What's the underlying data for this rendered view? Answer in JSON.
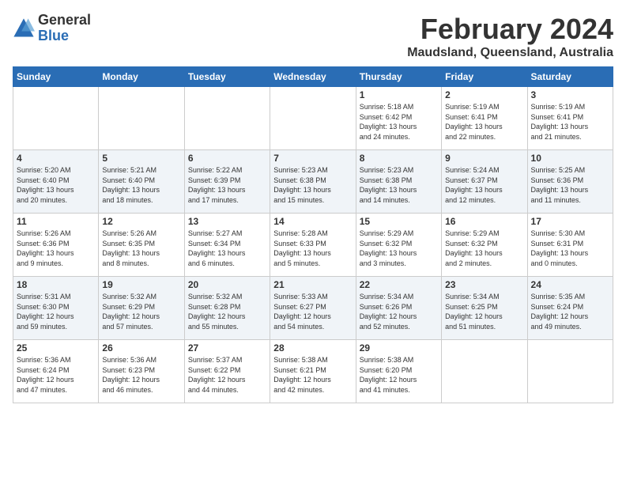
{
  "header": {
    "logo_line1": "General",
    "logo_line2": "Blue",
    "title": "February 2024",
    "subtitle": "Maudsland, Queensland, Australia"
  },
  "calendar": {
    "days_of_week": [
      "Sunday",
      "Monday",
      "Tuesday",
      "Wednesday",
      "Thursday",
      "Friday",
      "Saturday"
    ],
    "weeks": [
      [
        {
          "day": "",
          "info": ""
        },
        {
          "day": "",
          "info": ""
        },
        {
          "day": "",
          "info": ""
        },
        {
          "day": "",
          "info": ""
        },
        {
          "day": "1",
          "info": "Sunrise: 5:18 AM\nSunset: 6:42 PM\nDaylight: 13 hours\nand 24 minutes."
        },
        {
          "day": "2",
          "info": "Sunrise: 5:19 AM\nSunset: 6:41 PM\nDaylight: 13 hours\nand 22 minutes."
        },
        {
          "day": "3",
          "info": "Sunrise: 5:19 AM\nSunset: 6:41 PM\nDaylight: 13 hours\nand 21 minutes."
        }
      ],
      [
        {
          "day": "4",
          "info": "Sunrise: 5:20 AM\nSunset: 6:40 PM\nDaylight: 13 hours\nand 20 minutes."
        },
        {
          "day": "5",
          "info": "Sunrise: 5:21 AM\nSunset: 6:40 PM\nDaylight: 13 hours\nand 18 minutes."
        },
        {
          "day": "6",
          "info": "Sunrise: 5:22 AM\nSunset: 6:39 PM\nDaylight: 13 hours\nand 17 minutes."
        },
        {
          "day": "7",
          "info": "Sunrise: 5:23 AM\nSunset: 6:38 PM\nDaylight: 13 hours\nand 15 minutes."
        },
        {
          "day": "8",
          "info": "Sunrise: 5:23 AM\nSunset: 6:38 PM\nDaylight: 13 hours\nand 14 minutes."
        },
        {
          "day": "9",
          "info": "Sunrise: 5:24 AM\nSunset: 6:37 PM\nDaylight: 13 hours\nand 12 minutes."
        },
        {
          "day": "10",
          "info": "Sunrise: 5:25 AM\nSunset: 6:36 PM\nDaylight: 13 hours\nand 11 minutes."
        }
      ],
      [
        {
          "day": "11",
          "info": "Sunrise: 5:26 AM\nSunset: 6:36 PM\nDaylight: 13 hours\nand 9 minutes."
        },
        {
          "day": "12",
          "info": "Sunrise: 5:26 AM\nSunset: 6:35 PM\nDaylight: 13 hours\nand 8 minutes."
        },
        {
          "day": "13",
          "info": "Sunrise: 5:27 AM\nSunset: 6:34 PM\nDaylight: 13 hours\nand 6 minutes."
        },
        {
          "day": "14",
          "info": "Sunrise: 5:28 AM\nSunset: 6:33 PM\nDaylight: 13 hours\nand 5 minutes."
        },
        {
          "day": "15",
          "info": "Sunrise: 5:29 AM\nSunset: 6:32 PM\nDaylight: 13 hours\nand 3 minutes."
        },
        {
          "day": "16",
          "info": "Sunrise: 5:29 AM\nSunset: 6:32 PM\nDaylight: 13 hours\nand 2 minutes."
        },
        {
          "day": "17",
          "info": "Sunrise: 5:30 AM\nSunset: 6:31 PM\nDaylight: 13 hours\nand 0 minutes."
        }
      ],
      [
        {
          "day": "18",
          "info": "Sunrise: 5:31 AM\nSunset: 6:30 PM\nDaylight: 12 hours\nand 59 minutes."
        },
        {
          "day": "19",
          "info": "Sunrise: 5:32 AM\nSunset: 6:29 PM\nDaylight: 12 hours\nand 57 minutes."
        },
        {
          "day": "20",
          "info": "Sunrise: 5:32 AM\nSunset: 6:28 PM\nDaylight: 12 hours\nand 55 minutes."
        },
        {
          "day": "21",
          "info": "Sunrise: 5:33 AM\nSunset: 6:27 PM\nDaylight: 12 hours\nand 54 minutes."
        },
        {
          "day": "22",
          "info": "Sunrise: 5:34 AM\nSunset: 6:26 PM\nDaylight: 12 hours\nand 52 minutes."
        },
        {
          "day": "23",
          "info": "Sunrise: 5:34 AM\nSunset: 6:25 PM\nDaylight: 12 hours\nand 51 minutes."
        },
        {
          "day": "24",
          "info": "Sunrise: 5:35 AM\nSunset: 6:24 PM\nDaylight: 12 hours\nand 49 minutes."
        }
      ],
      [
        {
          "day": "25",
          "info": "Sunrise: 5:36 AM\nSunset: 6:24 PM\nDaylight: 12 hours\nand 47 minutes."
        },
        {
          "day": "26",
          "info": "Sunrise: 5:36 AM\nSunset: 6:23 PM\nDaylight: 12 hours\nand 46 minutes."
        },
        {
          "day": "27",
          "info": "Sunrise: 5:37 AM\nSunset: 6:22 PM\nDaylight: 12 hours\nand 44 minutes."
        },
        {
          "day": "28",
          "info": "Sunrise: 5:38 AM\nSunset: 6:21 PM\nDaylight: 12 hours\nand 42 minutes."
        },
        {
          "day": "29",
          "info": "Sunrise: 5:38 AM\nSunset: 6:20 PM\nDaylight: 12 hours\nand 41 minutes."
        },
        {
          "day": "",
          "info": ""
        },
        {
          "day": "",
          "info": ""
        }
      ]
    ]
  }
}
